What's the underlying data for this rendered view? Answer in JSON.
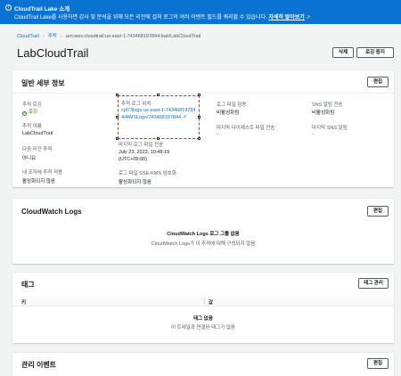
{
  "banner": {
    "title": "CloudTrail Lake 소개",
    "desc": "CloudTrail Lake를 사용하면 감사 및 분석을 위해 모든 리전에 걸쳐 로그의 여러 이벤트 필드를 쿼리할 수 있습니다.",
    "link": "자세히 알아보기",
    "info_icon": "info-icon",
    "external_icon": "external-link-icon"
  },
  "breadcrumb": {
    "root": "CloudTrail",
    "trails": "추적",
    "current": "arn:aws:cloudtrail:us-east-1:743468197844:trail/LabCloudTrail"
  },
  "page_title": "LabCloudTrail",
  "header_buttons": {
    "delete": "삭제",
    "stop_logging": "로깅 중지"
  },
  "general": {
    "heading": "일반 세부 정보",
    "edit": "편집",
    "trail_logging_label": "추적 로깅",
    "trail_logging_value": "로깅",
    "trail_name_label": "추적 이름",
    "trail_name_value": "LabCloudTrail",
    "multi_region_label": "다중 리전 추적",
    "multi_region_value": "아니요",
    "org_trail_label": "내 조직에 추적 적용",
    "org_trail_value": "활성화되지 않음",
    "log_location_label": "추적 로그 위치",
    "log_location_value": "cpl73logs-us-east-1-743468197844/AWSLogs/743468197844",
    "last_delivery_label": "마지막 로그 파일 전송",
    "last_delivery_value": "July 23, 2023, 10:48:19 (UTC+09:00)",
    "sse_kms_label": "로그 파일 SSE-KMS 암호화",
    "sse_kms_value": "활성화되지 않음",
    "validation_label": "로그 파일 검증",
    "validation_value": "비활성화됨",
    "last_digest_label": "마지막 다이제스트 파일 전송",
    "last_digest_value": "-",
    "sns_label": "SNS 알림 전송",
    "sns_value": "비활성화됨",
    "last_sns_label": "마지막 SNS 알림",
    "last_sns_value": "-"
  },
  "cloudwatch": {
    "heading": "CloudWatch Logs",
    "edit": "편집",
    "empty_title": "CloudWatch Logs 로그 그룹 없음",
    "empty_desc": "CloudWatch Logs가 이 추적에 대해 구성되지 않음"
  },
  "tags": {
    "heading": "태그",
    "manage": "태그 관리",
    "col_key": "키",
    "col_value": "값",
    "empty_title": "태그 없음",
    "empty_desc": "이 트레일과 연결된 태그가 없음"
  },
  "management": {
    "heading": "관리 이벤트",
    "edit": "편집"
  }
}
